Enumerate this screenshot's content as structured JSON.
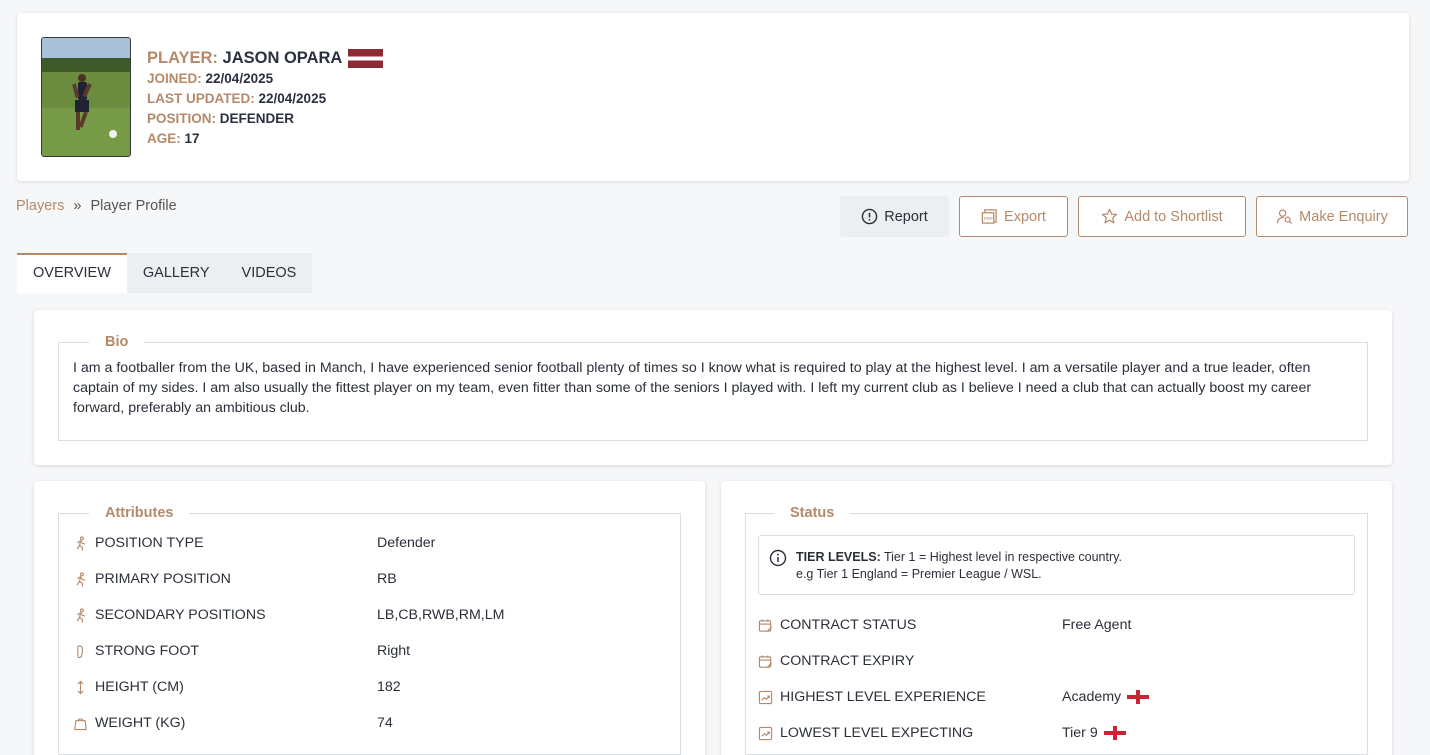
{
  "colors": {
    "accent": "#b5896a",
    "text": "#2b2f3a"
  },
  "player": {
    "name_label": "PLAYER:",
    "name": "JASON OPARA",
    "joined_label": "JOINED:",
    "joined": "22/04/2025",
    "updated_label": "LAST UPDATED:",
    "updated": "22/04/2025",
    "position_label": "POSITION:",
    "position": "DEFENDER",
    "age_label": "AGE:",
    "age": "17",
    "flag": "latvia-flag"
  },
  "breadcrumb": {
    "root": "Players",
    "separator": "»",
    "current": "Player Profile"
  },
  "actions": {
    "report": "Report",
    "export": "Export",
    "shortlist": "Add to Shortlist",
    "enquiry": "Make Enquiry"
  },
  "tabs": [
    "OVERVIEW",
    "GALLERY",
    "VIDEOS"
  ],
  "bio": {
    "title": "Bio",
    "text": "I am a footballer from the UK, based in Manch, I have experienced senior football plenty of times so I know what is required to play at the highest level. I am a versatile player and a true leader, often captain of my sides. I am also usually the fittest player on my team, even fitter than some of the seniors I played with. I left my current club as I believe I need a club that can actually boost my career forward, preferably an ambitious club."
  },
  "attributes": {
    "title": "Attributes",
    "items": [
      {
        "label": "POSITION TYPE",
        "value": "Defender",
        "icon": "running-icon"
      },
      {
        "label": "PRIMARY POSITION",
        "value": "RB",
        "icon": "running-icon"
      },
      {
        "label": "SECONDARY POSITIONS",
        "value": "LB,CB,RWB,RM,LM",
        "icon": "running-icon"
      },
      {
        "label": "STRONG FOOT",
        "value": "Right",
        "icon": "footprint-icon"
      },
      {
        "label": "HEIGHT (CM)",
        "value": "182",
        "icon": "height-arrow-icon"
      },
      {
        "label": "WEIGHT (KG)",
        "value": "74",
        "icon": "weight-icon"
      }
    ]
  },
  "status": {
    "title": "Status",
    "tier_bold": "TIER LEVELS:",
    "tier_line1": " Tier 1 = Highest level in respective country.",
    "tier_line2": "e.g Tier 1 England = Premier League / WSL.",
    "items": [
      {
        "label": "CONTRACT STATUS",
        "value": "Free Agent",
        "icon": "calendar-edit-icon"
      },
      {
        "label": "CONTRACT EXPIRY",
        "value": "",
        "icon": "calendar-edit-icon"
      },
      {
        "label": "HIGHEST LEVEL EXPERIENCE",
        "value": "Academy",
        "icon": "trend-up-icon",
        "flag": "england-flag"
      },
      {
        "label": "LOWEST LEVEL EXPECTING",
        "value": "Tier 9",
        "icon": "trend-up-icon",
        "flag": "england-flag"
      }
    ]
  }
}
